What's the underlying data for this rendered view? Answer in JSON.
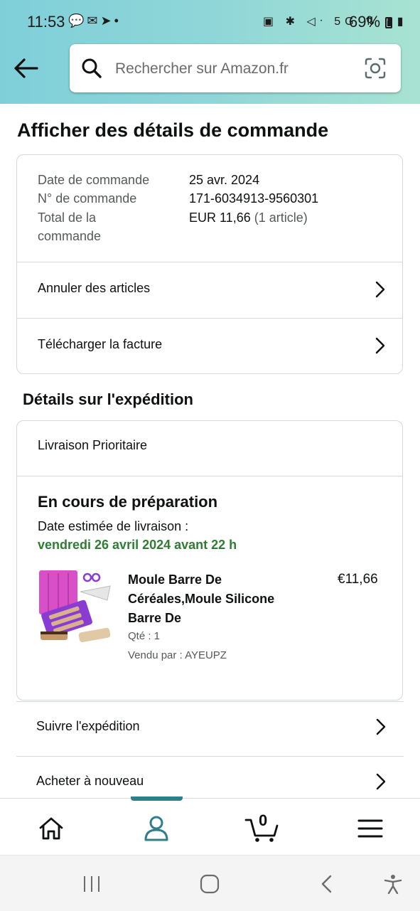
{
  "status_bar": {
    "time": "11:53",
    "left_icons": [
      "message-icon",
      "outlook-icon",
      "telegram-icon",
      "dot-icon"
    ],
    "right_icons_text": "▣ ✱ ◁ᐧ 5G ⇅ ▮▮",
    "battery": "69%"
  },
  "search": {
    "placeholder": "Rechercher sur Amazon.fr"
  },
  "page": {
    "title": "Afficher des détails de commande"
  },
  "summary": {
    "rows": [
      {
        "label": "Date de commande",
        "value": "25 avr. 2024"
      },
      {
        "label": "N° de commande",
        "value": "171-6034913-9560301"
      },
      {
        "label": "Total de la commande",
        "value": "EUR 11,66",
        "value_suffix": "(1 article)"
      }
    ],
    "total_label_line1": "Total de la",
    "total_label_line2": "commande",
    "actions": [
      {
        "label": "Annuler des articles"
      },
      {
        "label": "Télécharger la facture"
      }
    ]
  },
  "shipment": {
    "section_title": "Détails sur l'expédition",
    "method": "Livraison Prioritaire",
    "status": "En cours de préparation",
    "estimate_label": "Date estimée de livraison :",
    "estimate_date": "vendredi 26 avril 2024 avant 22 h",
    "estimate_color": "#2e7d32",
    "item": {
      "title_line1": "Moule Barre De",
      "title_line2": "Céréales,Moule Silicone",
      "title_line3": "Barre De",
      "price": "€11,66",
      "qty": "Qté : 1",
      "seller": "Vendu par : AYEUPZ"
    }
  },
  "links": [
    {
      "label": "Suivre l'expédition"
    },
    {
      "label": "Acheter à nouveau"
    }
  ],
  "bottom_nav": {
    "items": [
      "home-icon",
      "account-icon",
      "cart-icon",
      "menu-icon"
    ],
    "active": "account-icon",
    "cart_count": "0",
    "accent": "#2f7f8b"
  },
  "system_nav": [
    "recents-icon",
    "home-circle-icon",
    "back-chevron-icon",
    "accessibility-icon"
  ]
}
